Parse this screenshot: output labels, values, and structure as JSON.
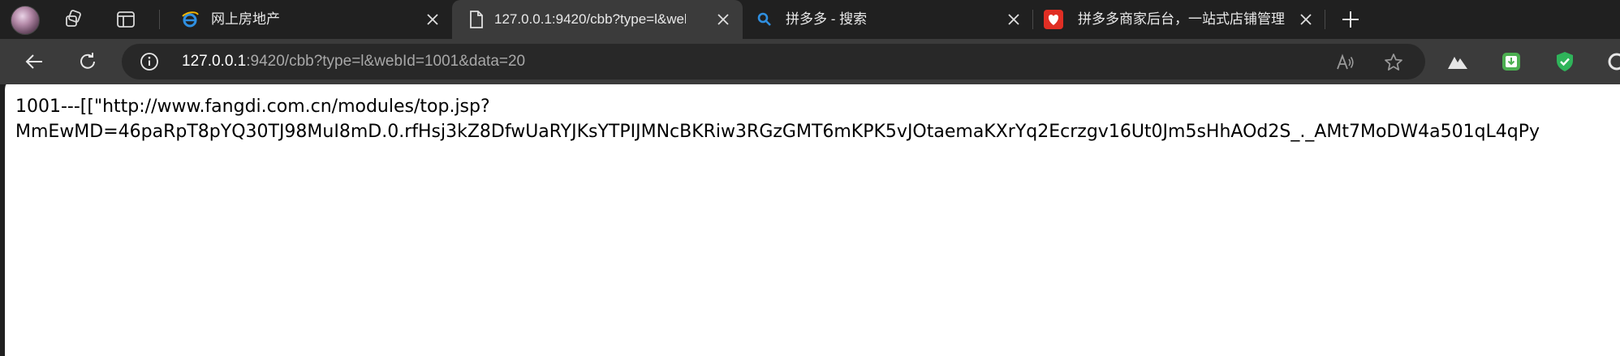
{
  "tabs": [
    {
      "title": "网上房地产",
      "favicon": "ie-globe-icon",
      "active": false
    },
    {
      "title": "127.0.0.1:9420/cbb?type=l&webI",
      "favicon": "document-icon",
      "active": true
    },
    {
      "title": "拼多多 - 搜索",
      "favicon": "search-icon",
      "active": false
    },
    {
      "title": "拼多多商家后台，一站式店铺管理",
      "favicon": "pinduoduo-icon",
      "active": false
    }
  ],
  "address_bar": {
    "host": "127.0.0.1",
    "rest": ":9420/cbb?type=l&webId=1001&data=20"
  },
  "page": {
    "line1": "1001---[[\"http://www.fangdi.com.cn/modules/top.jsp?",
    "line2": "MmEwMD=46paRpT8pYQ30TJ98MuI8mD.0.rfHsj3kZ8DfwUaRYJKsYTPIJMNcBKRiw3RGzGMT6mKPK5vJOtaemaKXrYq2Ecrzgv16Ut0Jm5sHhAOd2S_._AMt7MoDW4a501qL4qPy"
  },
  "colors": {
    "tabstrip_bg": "#202020",
    "toolbar_bg": "#3b3b3b",
    "omnibox_bg": "#282828",
    "page_bg": "#ffffff"
  }
}
